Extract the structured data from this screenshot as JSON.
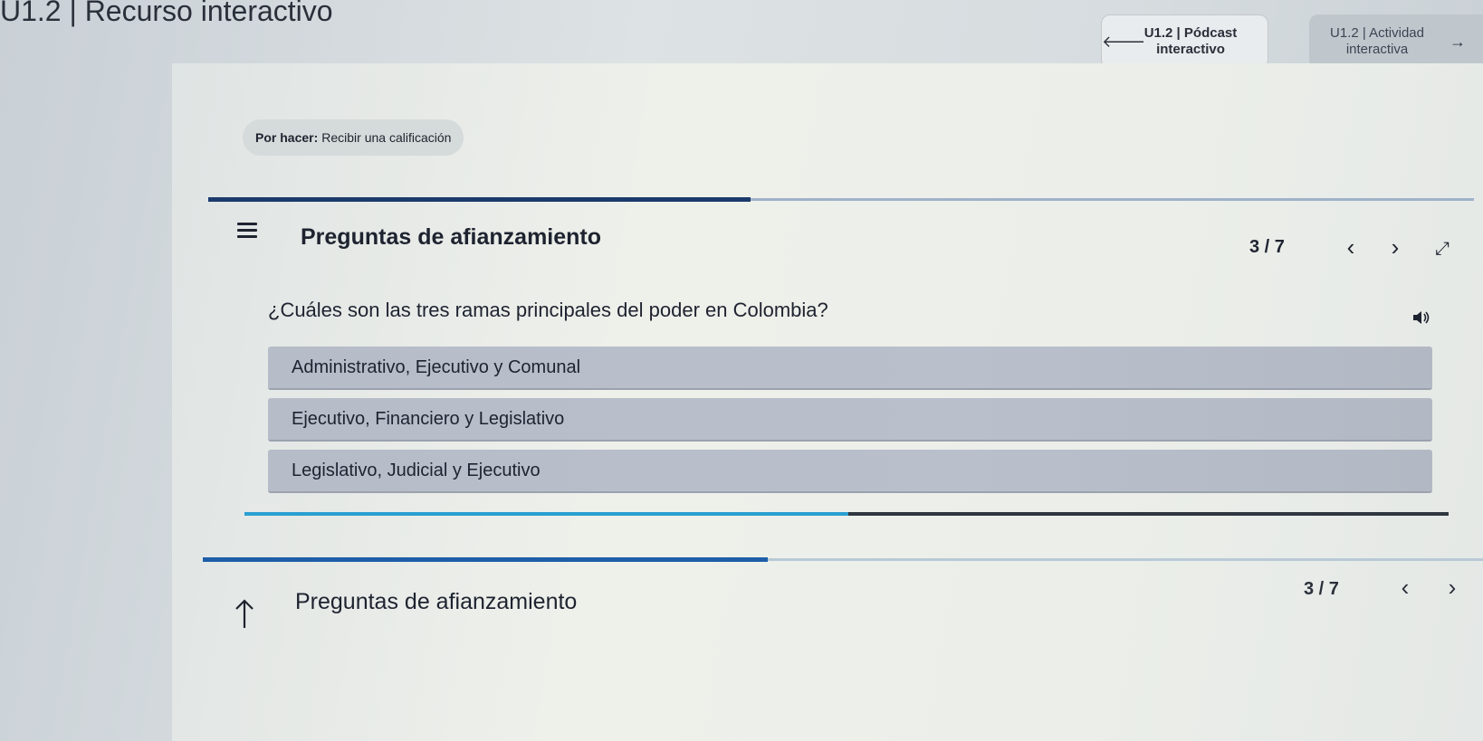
{
  "header": {
    "title": "U1.2 | Recurso interactivo",
    "prev_nav": {
      "label": "U1.2 | Pódcast interactivo",
      "icon": "arrow-left-icon"
    },
    "next_nav": {
      "label": "U1.2 | Actividad interactiva",
      "icon": "arrow-right-icon"
    }
  },
  "todo": {
    "prefix": "Por hacer:",
    "text": "Recibir una calificación"
  },
  "quiz": {
    "title": "Preguntas de afianzamiento",
    "counter": "3 / 7",
    "question": "¿Cuáles son las tres ramas principales del poder en Colombia?",
    "options": [
      {
        "label": "Administrativo, Ejecutivo y Comunal"
      },
      {
        "label": "Ejecutivo, Financiero y Legislativo"
      },
      {
        "label": "Legislativo, Judicial y Ejecutivo"
      }
    ],
    "progress_fraction": 0.4286
  },
  "bottom_bar": {
    "title": "Preguntas de afianzamiento",
    "counter": "3 / 7"
  },
  "colors": {
    "progress_fill": "#1b3a6b",
    "progress_rest": "#9fb2c9",
    "progress_fill_light": "#2a9fd1",
    "option_bg": "#b8bec9",
    "nav_next_bg": "#c0c7cc"
  },
  "icons": {
    "menu": "menu-icon",
    "prev": "chevron-left-icon",
    "next": "chevron-right-icon",
    "fullscreen": "fullscreen-icon",
    "audio": "speaker-icon",
    "collapse": "arrow-up-icon"
  }
}
